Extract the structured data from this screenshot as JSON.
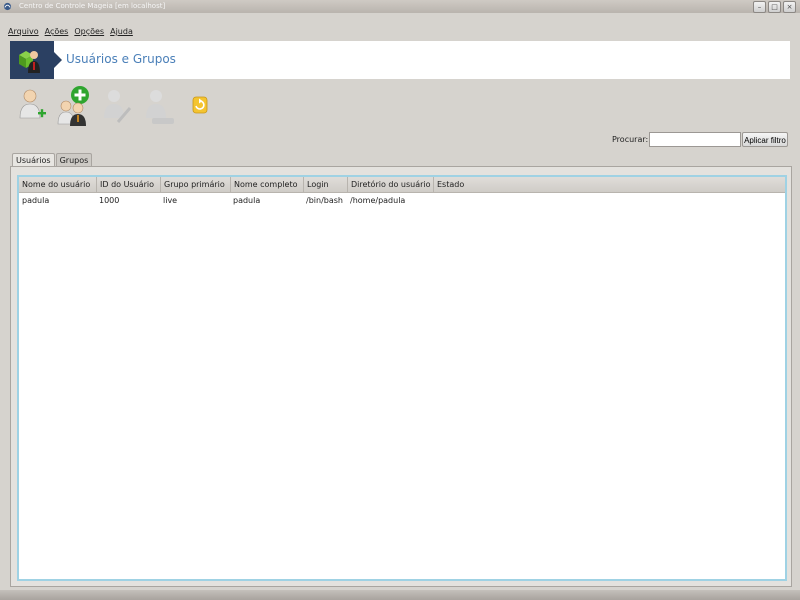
{
  "window": {
    "title": "Centro de Controle Mageia  [em localhost]",
    "controls": [
      "–",
      "□",
      "×"
    ]
  },
  "menu": [
    "Arquivo",
    "Ações",
    "Opções",
    "Ajuda"
  ],
  "banner": {
    "title": "Usuários e Grupos"
  },
  "toolbar": {
    "icons": [
      "add-user-icon",
      "add-group-icon",
      "edit-icon",
      "delete-icon",
      "refresh-icon"
    ]
  },
  "search": {
    "label": "Procurar:",
    "value": "",
    "button_label": "Aplicar filtro"
  },
  "tabs": [
    {
      "label": "Usuários"
    },
    {
      "label": "Grupos"
    }
  ],
  "table": {
    "columns": [
      "Nome do usuário",
      "ID do Usuário",
      "Grupo primário",
      "Nome completo",
      "Login",
      "Diretório do usuário",
      "Estado"
    ],
    "rows": [
      [
        "padula",
        "1000",
        "live",
        "padula",
        "/bin/bash",
        "/home/padula",
        ""
      ]
    ]
  },
  "colors": {
    "banner_title": "#4a7fb8",
    "banner_logo_bg": "#2b4062",
    "table_frame": "#9fd2e4",
    "add_badge": "#2fa52f"
  }
}
